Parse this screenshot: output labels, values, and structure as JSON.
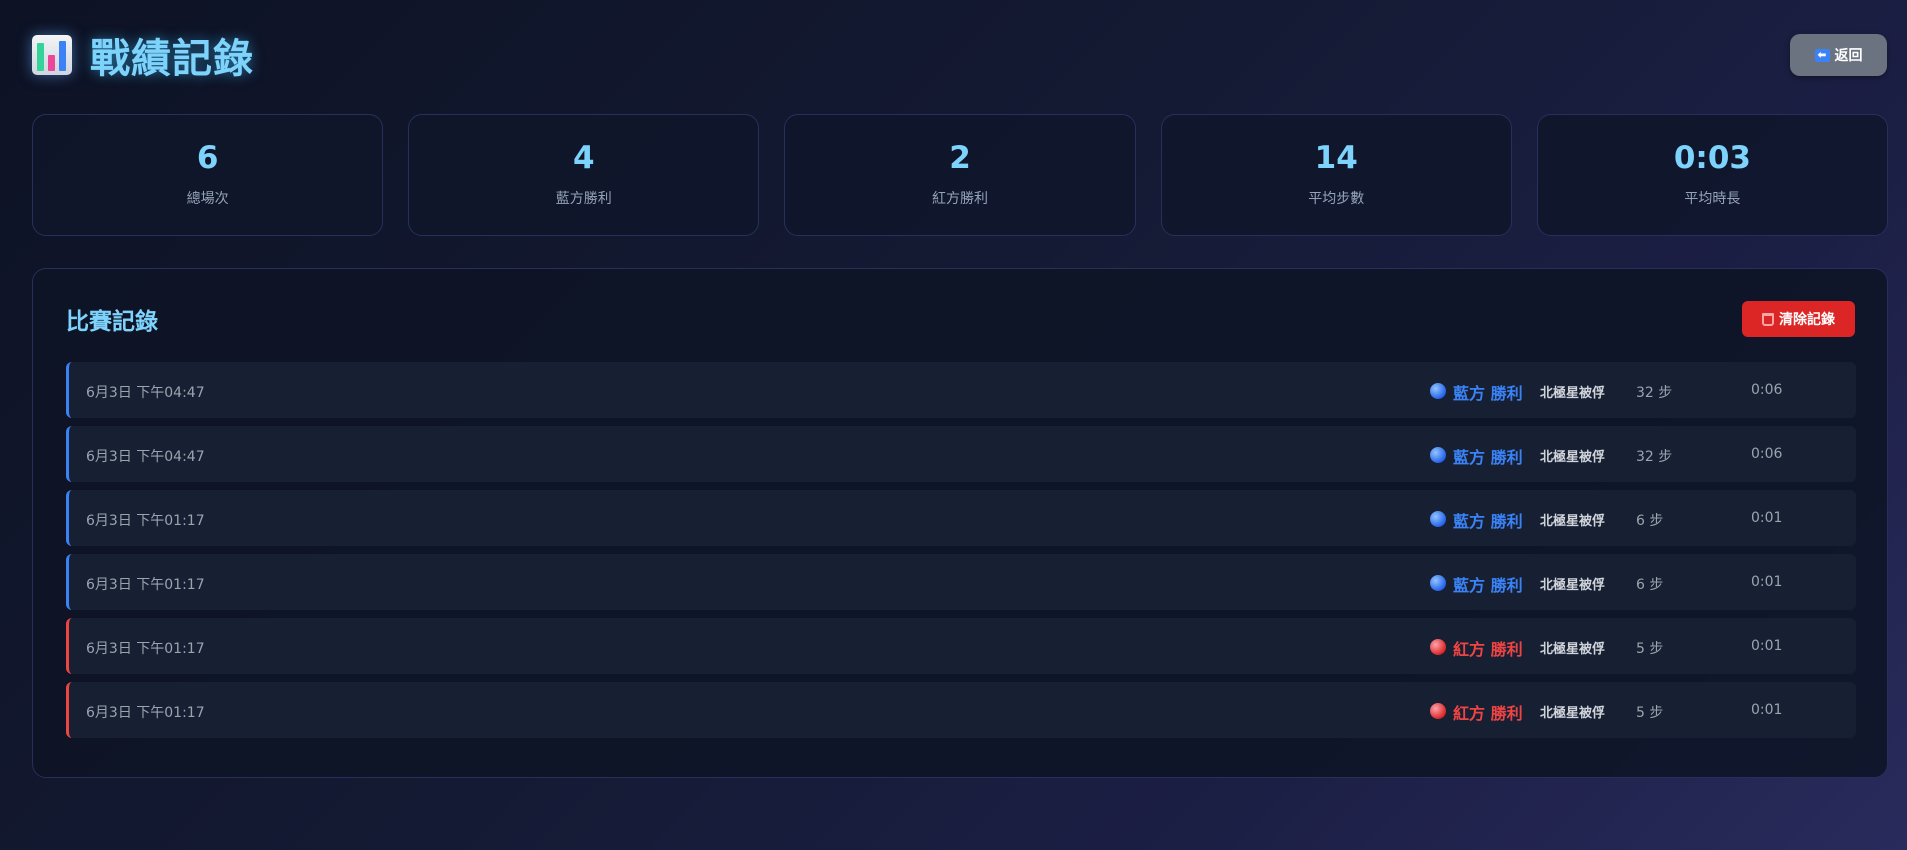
{
  "header": {
    "icon": "bar-chart-icon",
    "title": "戰績記錄",
    "back_icon": "left-arrow-icon",
    "back_label": "返回"
  },
  "stats": [
    {
      "value": "6",
      "label": "總場次"
    },
    {
      "value": "4",
      "label": "藍方勝利"
    },
    {
      "value": "2",
      "label": "紅方勝利"
    },
    {
      "value": "14",
      "label": "平均步數"
    },
    {
      "value": "0:03",
      "label": "平均時長"
    }
  ],
  "records_panel": {
    "title": "比賽記錄",
    "clear_icon": "trash-icon",
    "clear_label": "清除記錄",
    "records": [
      {
        "side": "blue",
        "date": "6月3日 下午04:47",
        "result": "藍方 勝利",
        "reason": "北極星被俘",
        "moves": "32 步",
        "duration": "0:06"
      },
      {
        "side": "blue",
        "date": "6月3日 下午04:47",
        "result": "藍方 勝利",
        "reason": "北極星被俘",
        "moves": "32 步",
        "duration": "0:06"
      },
      {
        "side": "blue",
        "date": "6月3日 下午01:17",
        "result": "藍方 勝利",
        "reason": "北極星被俘",
        "moves": "6 步",
        "duration": "0:01"
      },
      {
        "side": "blue",
        "date": "6月3日 下午01:17",
        "result": "藍方 勝利",
        "reason": "北極星被俘",
        "moves": "6 步",
        "duration": "0:01"
      },
      {
        "side": "red",
        "date": "6月3日 下午01:17",
        "result": "紅方 勝利",
        "reason": "北極星被俘",
        "moves": "5 步",
        "duration": "0:01"
      },
      {
        "side": "red",
        "date": "6月3日 下午01:17",
        "result": "紅方 勝利",
        "reason": "北極星被俘",
        "moves": "5 步",
        "duration": "0:01"
      }
    ]
  },
  "colors": {
    "accent": "#7dd3fc",
    "blue_team": "#3b82f6",
    "red_team": "#ef4444",
    "danger_button": "#dc2626",
    "neutral_button": "#6b7280"
  }
}
